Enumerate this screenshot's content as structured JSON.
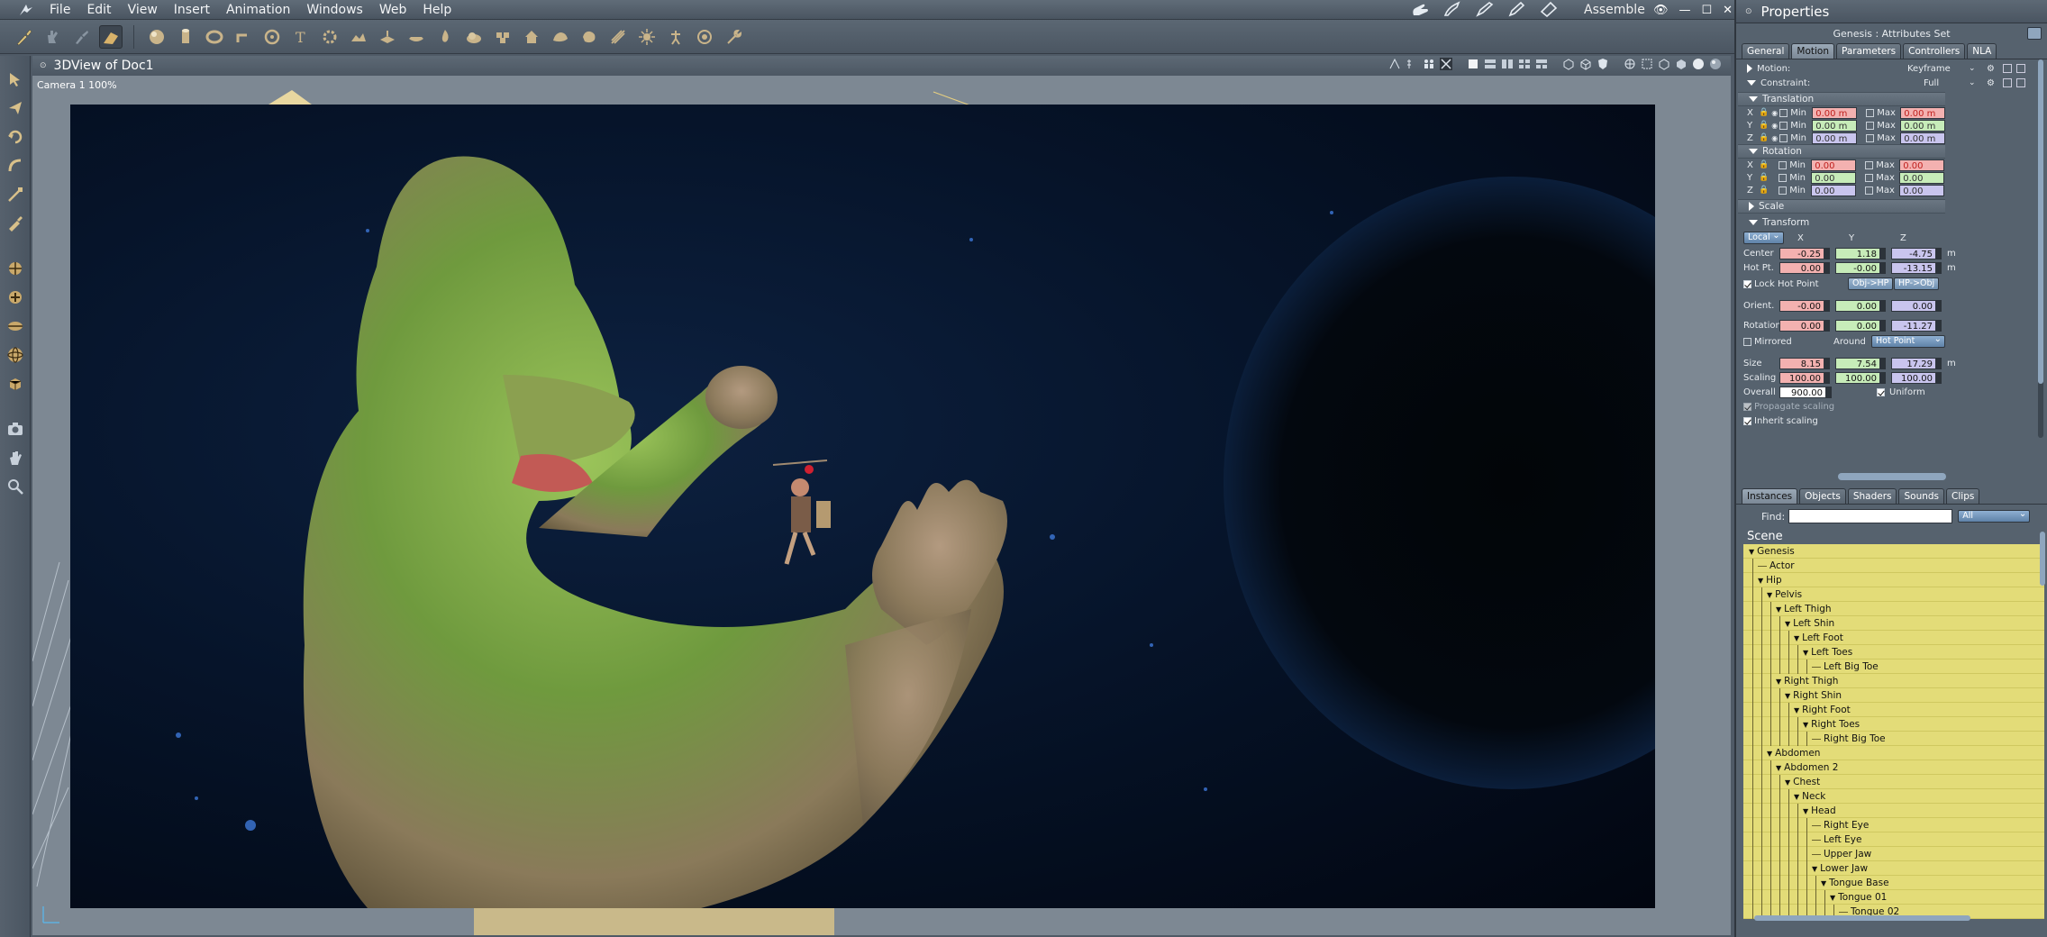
{
  "menubar": {
    "items": [
      "File",
      "Edit",
      "View",
      "Insert",
      "Animation",
      "Windows",
      "Web",
      "Help"
    ],
    "room": "Assemble"
  },
  "viewport": {
    "title": "3DView of Doc1",
    "camera_label": "Camera 1 100%"
  },
  "properties": {
    "title": "Properties",
    "subtitle": "Genesis : Attributes Set",
    "tabs": [
      "General",
      "Motion",
      "Parameters",
      "Controllers",
      "NLA"
    ],
    "active_tab": "Motion",
    "motion_label": "Motion:",
    "motion_value": "Keyframe",
    "constraint_label": "Constraint:",
    "constraint_value": "Full",
    "translation": {
      "title": "Translation",
      "min_label": "Min",
      "max_label": "Max",
      "rows": [
        {
          "axis": "X",
          "min": "0.00 m",
          "max": "0.00 m"
        },
        {
          "axis": "Y",
          "min": "0.00 m",
          "max": "0.00 m"
        },
        {
          "axis": "Z",
          "min": "0.00 m",
          "max": "0.00 m"
        }
      ]
    },
    "rotation": {
      "title": "Rotation",
      "rows": [
        {
          "axis": "X",
          "min": "0.00",
          "max": "0.00"
        },
        {
          "axis": "Y",
          "min": "0.00",
          "max": "0.00"
        },
        {
          "axis": "Z",
          "min": "0.00",
          "max": "0.00"
        }
      ]
    },
    "scale_title": "Scale",
    "transform": {
      "title": "Transform",
      "space": "Local",
      "col_x": "X",
      "col_y": "Y",
      "col_z": "Z",
      "unit": "m",
      "center_label": "Center",
      "center": [
        "-0.25",
        "1.18",
        "-4.75"
      ],
      "hotpt_label": "Hot Pt.",
      "hotpt": [
        "0.00",
        "-0.00",
        "-13.15"
      ],
      "lock_hot_point": "Lock Hot Point",
      "obj_hp": "Obj->HP",
      "hp_obj": "HP->Obj",
      "orient_label": "Orient.",
      "orient": [
        "-0.00",
        "0.00",
        "0.00"
      ],
      "rotation_label": "Rotation",
      "rotation": [
        "0.00",
        "0.00",
        "-11.27"
      ],
      "mirrored": "Mirrored",
      "around": "Around",
      "around_value": "Hot Point",
      "size_label": "Size",
      "size": [
        "8.15",
        "7.54",
        "17.29"
      ],
      "scaling_label": "Scaling",
      "scaling": [
        "100.00",
        "100.00",
        "100.00"
      ],
      "overall_label": "Overall",
      "overall": "900.00",
      "uniform": "Uniform",
      "propagate": "Propagate scaling",
      "inherit": "Inherit scaling"
    }
  },
  "browser": {
    "tabs": [
      "Instances",
      "Objects",
      "Shaders",
      "Sounds",
      "Clips"
    ],
    "active_tab": "Instances",
    "find_label": "Find:",
    "filter_value": "All",
    "scene_label": "Scene",
    "tree": [
      {
        "label": "Genesis",
        "depth": 0,
        "open": true
      },
      {
        "label": "Actor",
        "depth": 1
      },
      {
        "label": "Hip",
        "depth": 1,
        "open": true
      },
      {
        "label": "Pelvis",
        "depth": 2,
        "open": true
      },
      {
        "label": "Left Thigh",
        "depth": 3,
        "open": true
      },
      {
        "label": "Left Shin",
        "depth": 4,
        "open": true
      },
      {
        "label": "Left Foot",
        "depth": 5,
        "open": true
      },
      {
        "label": "Left Toes",
        "depth": 6,
        "open": true
      },
      {
        "label": "Left Big Toe",
        "depth": 7
      },
      {
        "label": "Right Thigh",
        "depth": 3,
        "open": true
      },
      {
        "label": "Right Shin",
        "depth": 4,
        "open": true
      },
      {
        "label": "Right Foot",
        "depth": 5,
        "open": true
      },
      {
        "label": "Right Toes",
        "depth": 6,
        "open": true
      },
      {
        "label": "Right Big Toe",
        "depth": 7
      },
      {
        "label": "Abdomen",
        "depth": 2,
        "open": true
      },
      {
        "label": "Abdomen 2",
        "depth": 3,
        "open": true
      },
      {
        "label": "Chest",
        "depth": 4,
        "open": true
      },
      {
        "label": "Neck",
        "depth": 5,
        "open": true
      },
      {
        "label": "Head",
        "depth": 6,
        "open": true
      },
      {
        "label": "Right Eye",
        "depth": 7
      },
      {
        "label": "Left Eye",
        "depth": 7
      },
      {
        "label": "Upper Jaw",
        "depth": 7
      },
      {
        "label": "Lower Jaw",
        "depth": 7,
        "open": true
      },
      {
        "label": "Tongue Base",
        "depth": 8,
        "open": true
      },
      {
        "label": "Tongue 01",
        "depth": 9,
        "open": true
      },
      {
        "label": "Tongue 02",
        "depth": 10
      }
    ]
  },
  "colors": {
    "accent_blue": "#7f9fc2",
    "tree_yellow": "#e3dc78",
    "x_red": "#f3b1b0",
    "y_green": "#c7ecb9",
    "z_blue": "#c9c5ee"
  }
}
